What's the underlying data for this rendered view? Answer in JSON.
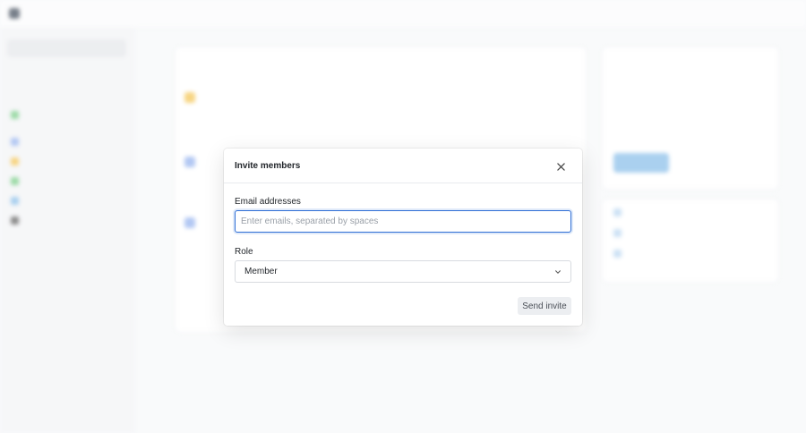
{
  "modal": {
    "title": "Invite members",
    "email_label": "Email addresses",
    "email_placeholder": "Enter emails, separated by spaces",
    "email_value": "",
    "role_label": "Role",
    "role_selected": "Member",
    "send_label": "Send invite"
  },
  "colors": {
    "focus_ring": "#2f6fd6",
    "scrim": "rgba(255,255,255,0.25)"
  },
  "icons": {
    "close": "close-icon",
    "chevron": "chevron-down-icon"
  }
}
